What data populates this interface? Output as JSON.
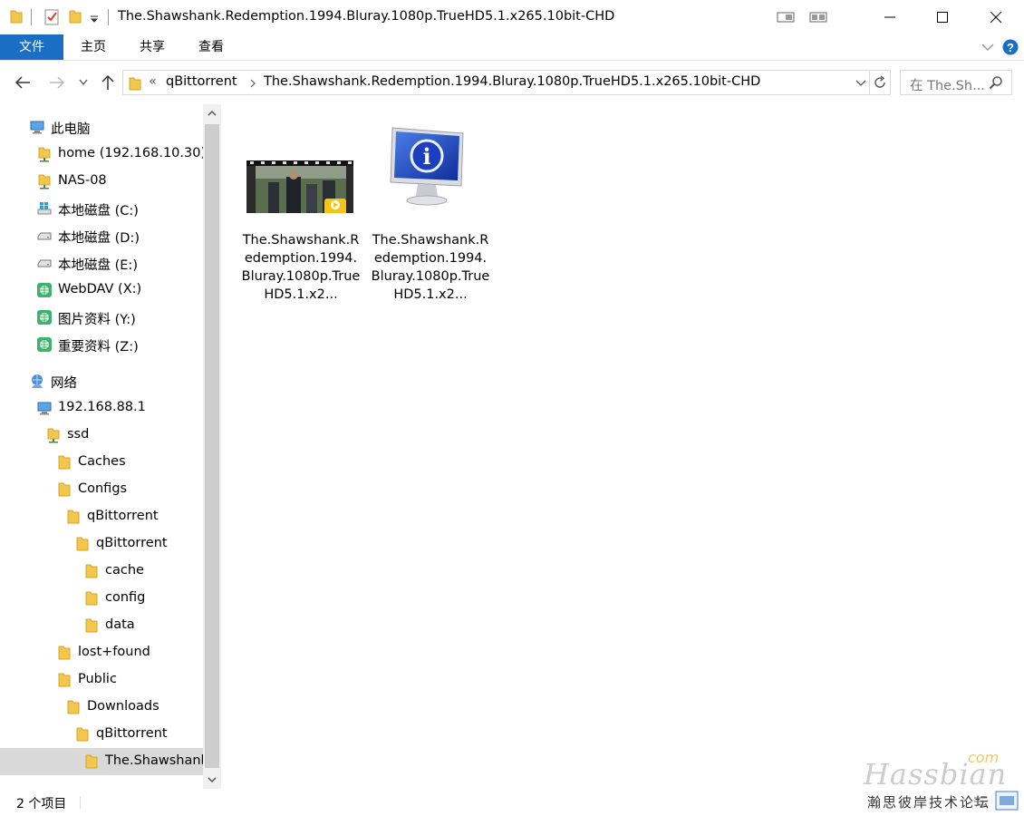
{
  "window": {
    "title": "The.Shawshank.Redemption.1994.Bluray.1080p.TrueHD5.1.x265.10bit-CHD"
  },
  "ribbon": {
    "tabs": [
      "文件",
      "主页",
      "共享",
      "查看"
    ]
  },
  "address": {
    "overflow": "«",
    "crumbs": [
      "qBittorrent",
      "The.Shawshank.Redemption.1994.Bluray.1080p.TrueHD5.1.x265.10bit-CHD"
    ]
  },
  "search": {
    "placeholder": "在 The.Sh..."
  },
  "nav_tree": [
    {
      "label": "此电脑",
      "icon": "computer-icon"
    },
    {
      "label": "home (192.168.10.30)",
      "icon": "network-folder-icon"
    },
    {
      "label": "NAS-08",
      "icon": "network-folder-icon"
    },
    {
      "label": "本地磁盘 (C:)",
      "icon": "windows-drive-icon"
    },
    {
      "label": "本地磁盘 (D:)",
      "icon": "drive-icon"
    },
    {
      "label": "本地磁盘 (E:)",
      "icon": "drive-icon"
    },
    {
      "label": "WebDAV (X:)",
      "icon": "web-drive-icon"
    },
    {
      "label": "图片资料 (Y:)",
      "icon": "web-drive-icon"
    },
    {
      "label": "重要资料 (Z:)",
      "icon": "web-drive-icon"
    },
    {
      "label": "网络",
      "icon": "network-icon"
    },
    {
      "label": "192.168.88.1",
      "icon": "computer-icon"
    },
    {
      "label": "ssd",
      "icon": "network-folder-icon"
    },
    {
      "label": "Caches",
      "icon": "folder-icon"
    },
    {
      "label": "Configs",
      "icon": "folder-icon"
    },
    {
      "label": "qBittorrent",
      "icon": "folder-icon"
    },
    {
      "label": "qBittorrent",
      "icon": "folder-icon"
    },
    {
      "label": "cache",
      "icon": "folder-icon"
    },
    {
      "label": "config",
      "icon": "folder-icon"
    },
    {
      "label": "data",
      "icon": "folder-icon"
    },
    {
      "label": "lost+found",
      "icon": "folder-icon"
    },
    {
      "label": "Public",
      "icon": "folder-icon"
    },
    {
      "label": "Downloads",
      "icon": "folder-icon"
    },
    {
      "label": "qBittorrent",
      "icon": "folder-icon"
    },
    {
      "label": "The.Shawshank",
      "icon": "folder-icon"
    }
  ],
  "files": [
    {
      "name": "The.Shawshank.Redemption.1994.Bluray.1080p.TrueHD5.1.x2...",
      "icon": "video-thumbnail",
      "badge": "Player"
    },
    {
      "name": "The.Shawshank.Redemption.1994.Bluray.1080p.TrueHD5.1.x2...",
      "icon": "nfo-info-icon"
    }
  ],
  "status": {
    "count": "2 个项目"
  },
  "watermark": {
    "brand": "Hassbian",
    "suffix": "com",
    "tagline": "瀚思彼岸技术论坛"
  },
  "colors": {
    "accent": "#1a6fc4",
    "folder": "#f3c74e",
    "selected": "#d9d9d9"
  }
}
